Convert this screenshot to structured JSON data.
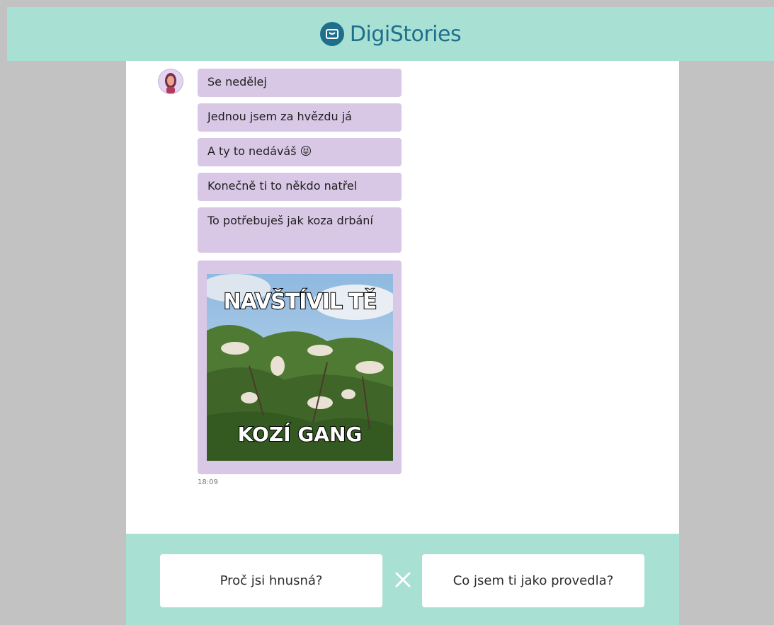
{
  "header": {
    "brand_name": "DigiStories",
    "brand_color": "#1e6f8c",
    "background_color": "#a8e0d3"
  },
  "chat": {
    "avatar_icon": "female-avatar-icon",
    "messages": [
      {
        "text": "Se nedělej"
      },
      {
        "text": "Jednou jsem za hvězdu já"
      },
      {
        "text": "A ty to nedáváš",
        "emoji": "😝"
      },
      {
        "text": "Konečně ti to někdo natřel"
      },
      {
        "text": "To potřebuješ jak koza drbání"
      }
    ],
    "meme": {
      "top_text": "NAVŠTÍVIL TĚ",
      "bottom_text": "KOZÍ GANG"
    },
    "timestamp": "18:09",
    "bubble_color": "#d8c8e6"
  },
  "choices": {
    "option_a": "Proč jsi hnusná?",
    "option_b": "Co jsem ti jako provedla?",
    "separator_icon": "x-icon"
  }
}
